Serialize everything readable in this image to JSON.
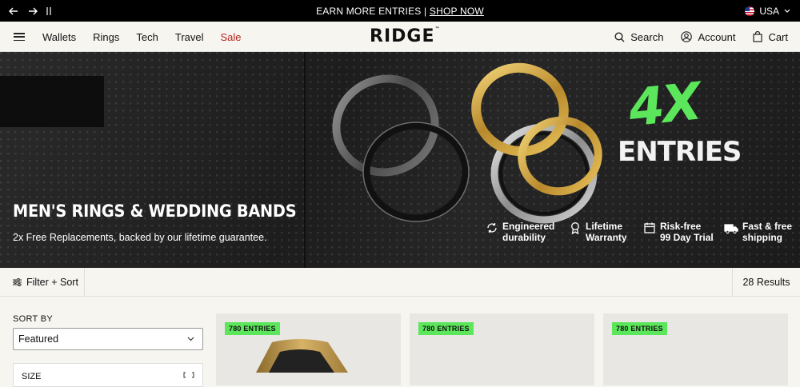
{
  "announcement": {
    "text": "EARN MORE ENTRIES | ",
    "link": "SHOP NOW",
    "region": "USA"
  },
  "header": {
    "logo": "RIDGE",
    "nav": [
      "Wallets",
      "Rings",
      "Tech",
      "Travel",
      "Sale"
    ],
    "search_label": "Search",
    "account_label": "Account",
    "cart_label": "Cart"
  },
  "hero": {
    "title": "MEN'S RINGS & WEDDING BANDS",
    "subtitle": "2x Free Replacements, backed by our lifetime guarantee.",
    "badge_top": "4X",
    "badge_bottom": "ENTRIES",
    "features": [
      {
        "line1": "Engineered",
        "line2": "durability",
        "icon": "recycle-icon"
      },
      {
        "line1": "Lifetime",
        "line2": "Warranty",
        "icon": "award-icon"
      },
      {
        "line1": "Risk-free",
        "line2": "99 Day Trial",
        "icon": "calendar-icon"
      },
      {
        "line1": "Fast & free",
        "line2": "shipping",
        "icon": "truck-icon"
      }
    ]
  },
  "filterbar": {
    "filter_label": "Filter + Sort",
    "results": "28 Results"
  },
  "sidebar": {
    "sort_label": "SORT BY",
    "sort_value": "Featured",
    "size_label": "SIZE"
  },
  "products": [
    {
      "tag": "780 ENTRIES"
    },
    {
      "tag": "780 ENTRIES"
    },
    {
      "tag": "780 ENTRIES"
    }
  ],
  "colors": {
    "accent_green": "#5ce65c",
    "sale_red": "#b3261e",
    "background": "#f7f5f0"
  }
}
